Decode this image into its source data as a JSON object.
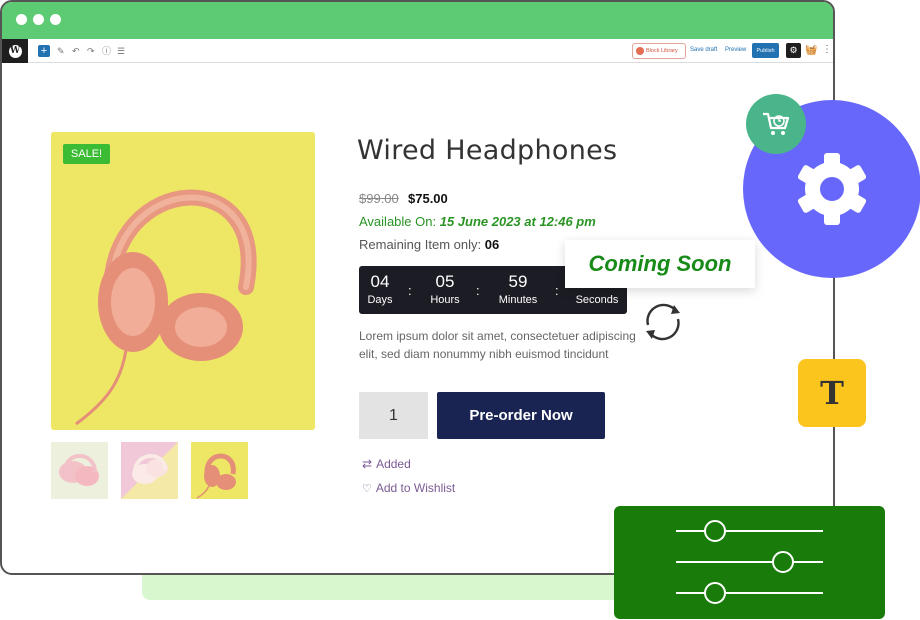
{
  "toolbar": {
    "block_library": "Block Library",
    "save_draft": "Save draft",
    "preview": "Preview",
    "publish": "Publish"
  },
  "product": {
    "sale_badge": "SALE!",
    "title": "Wired Headphones",
    "old_price": "$99.00",
    "new_price": "$75.00",
    "available_label": "Available On:",
    "available_date": "15 June 2023 at 12:46 pm",
    "remaining_label": "Remaining Item only:",
    "remaining_count": "06",
    "countdown": {
      "days": "04",
      "days_label": "Days",
      "hours": "05",
      "hours_label": "Hours",
      "minutes": "59",
      "minutes_label": "Minutes",
      "seconds_label": "Seconds"
    },
    "coming_soon": "Coming Soon",
    "description": "Lorem ipsum dolor sit amet, consectetuer adipiscing elit, sed diam nonummy nibh euismod tincidunt",
    "quantity": "1",
    "preorder_label": "Pre-order Now",
    "compare_label": "Added",
    "wishlist_label": "Add to Wishlist"
  },
  "decor": {
    "typography_letter": "T"
  },
  "colors": {
    "titlebar": "#5ccb73",
    "sale": "#3cbb34",
    "available": "#2a9424",
    "preorder_button": "#1a2452",
    "settings_circle": "#6767fb",
    "typography_box": "#fcc51e",
    "sliders_box": "#197b0a"
  }
}
